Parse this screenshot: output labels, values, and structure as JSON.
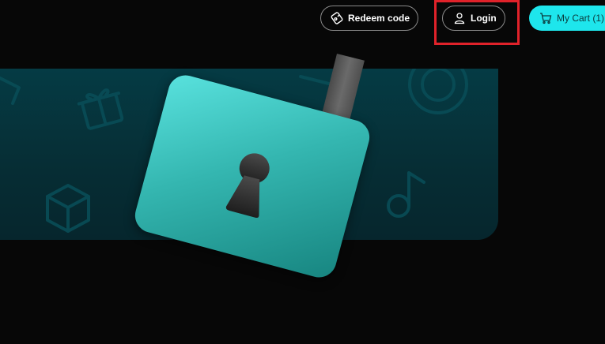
{
  "header": {
    "redeem_label": "Redeem code",
    "login_label": "Login",
    "cart_label": "My Cart (1)"
  },
  "icons": {
    "redeem": "gift-card-icon",
    "login": "user-icon",
    "cart": "shopping-cart-icon",
    "hero": "padlock-icon"
  },
  "colors": {
    "background": "#070707",
    "accent": "#1ee6ec",
    "banner": "#053b44",
    "highlight": "#e0222a"
  }
}
